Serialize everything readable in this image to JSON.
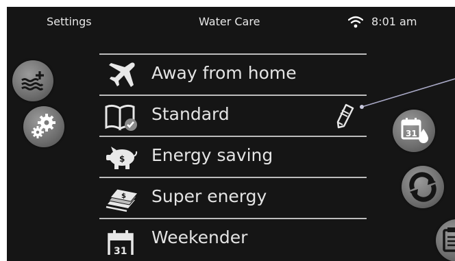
{
  "status_bar": {
    "left_label": "Settings",
    "title": "Water Care",
    "time": "8:01 am"
  },
  "side_buttons": {
    "left": [
      "water-plus-icon",
      "gears-icon"
    ],
    "right": [
      "calendar-drop-icon",
      "refresh-cycle-icon",
      "clipboard-icon"
    ]
  },
  "modes": [
    {
      "label": "Away from home",
      "icon": "airplane-icon"
    },
    {
      "label": "Standard",
      "icon": "book-check-icon",
      "selected": true,
      "editable": true
    },
    {
      "label": "Energy saving",
      "icon": "piggy-bank-icon"
    },
    {
      "label": "Super energy",
      "icon": "money-stack-icon"
    },
    {
      "label": "Weekender",
      "icon": "calendar-icon"
    }
  ],
  "colors": {
    "background": "#151515",
    "text": "#e4e4e4",
    "separator": "#bdbdbd",
    "button": "#7a7a7a"
  }
}
